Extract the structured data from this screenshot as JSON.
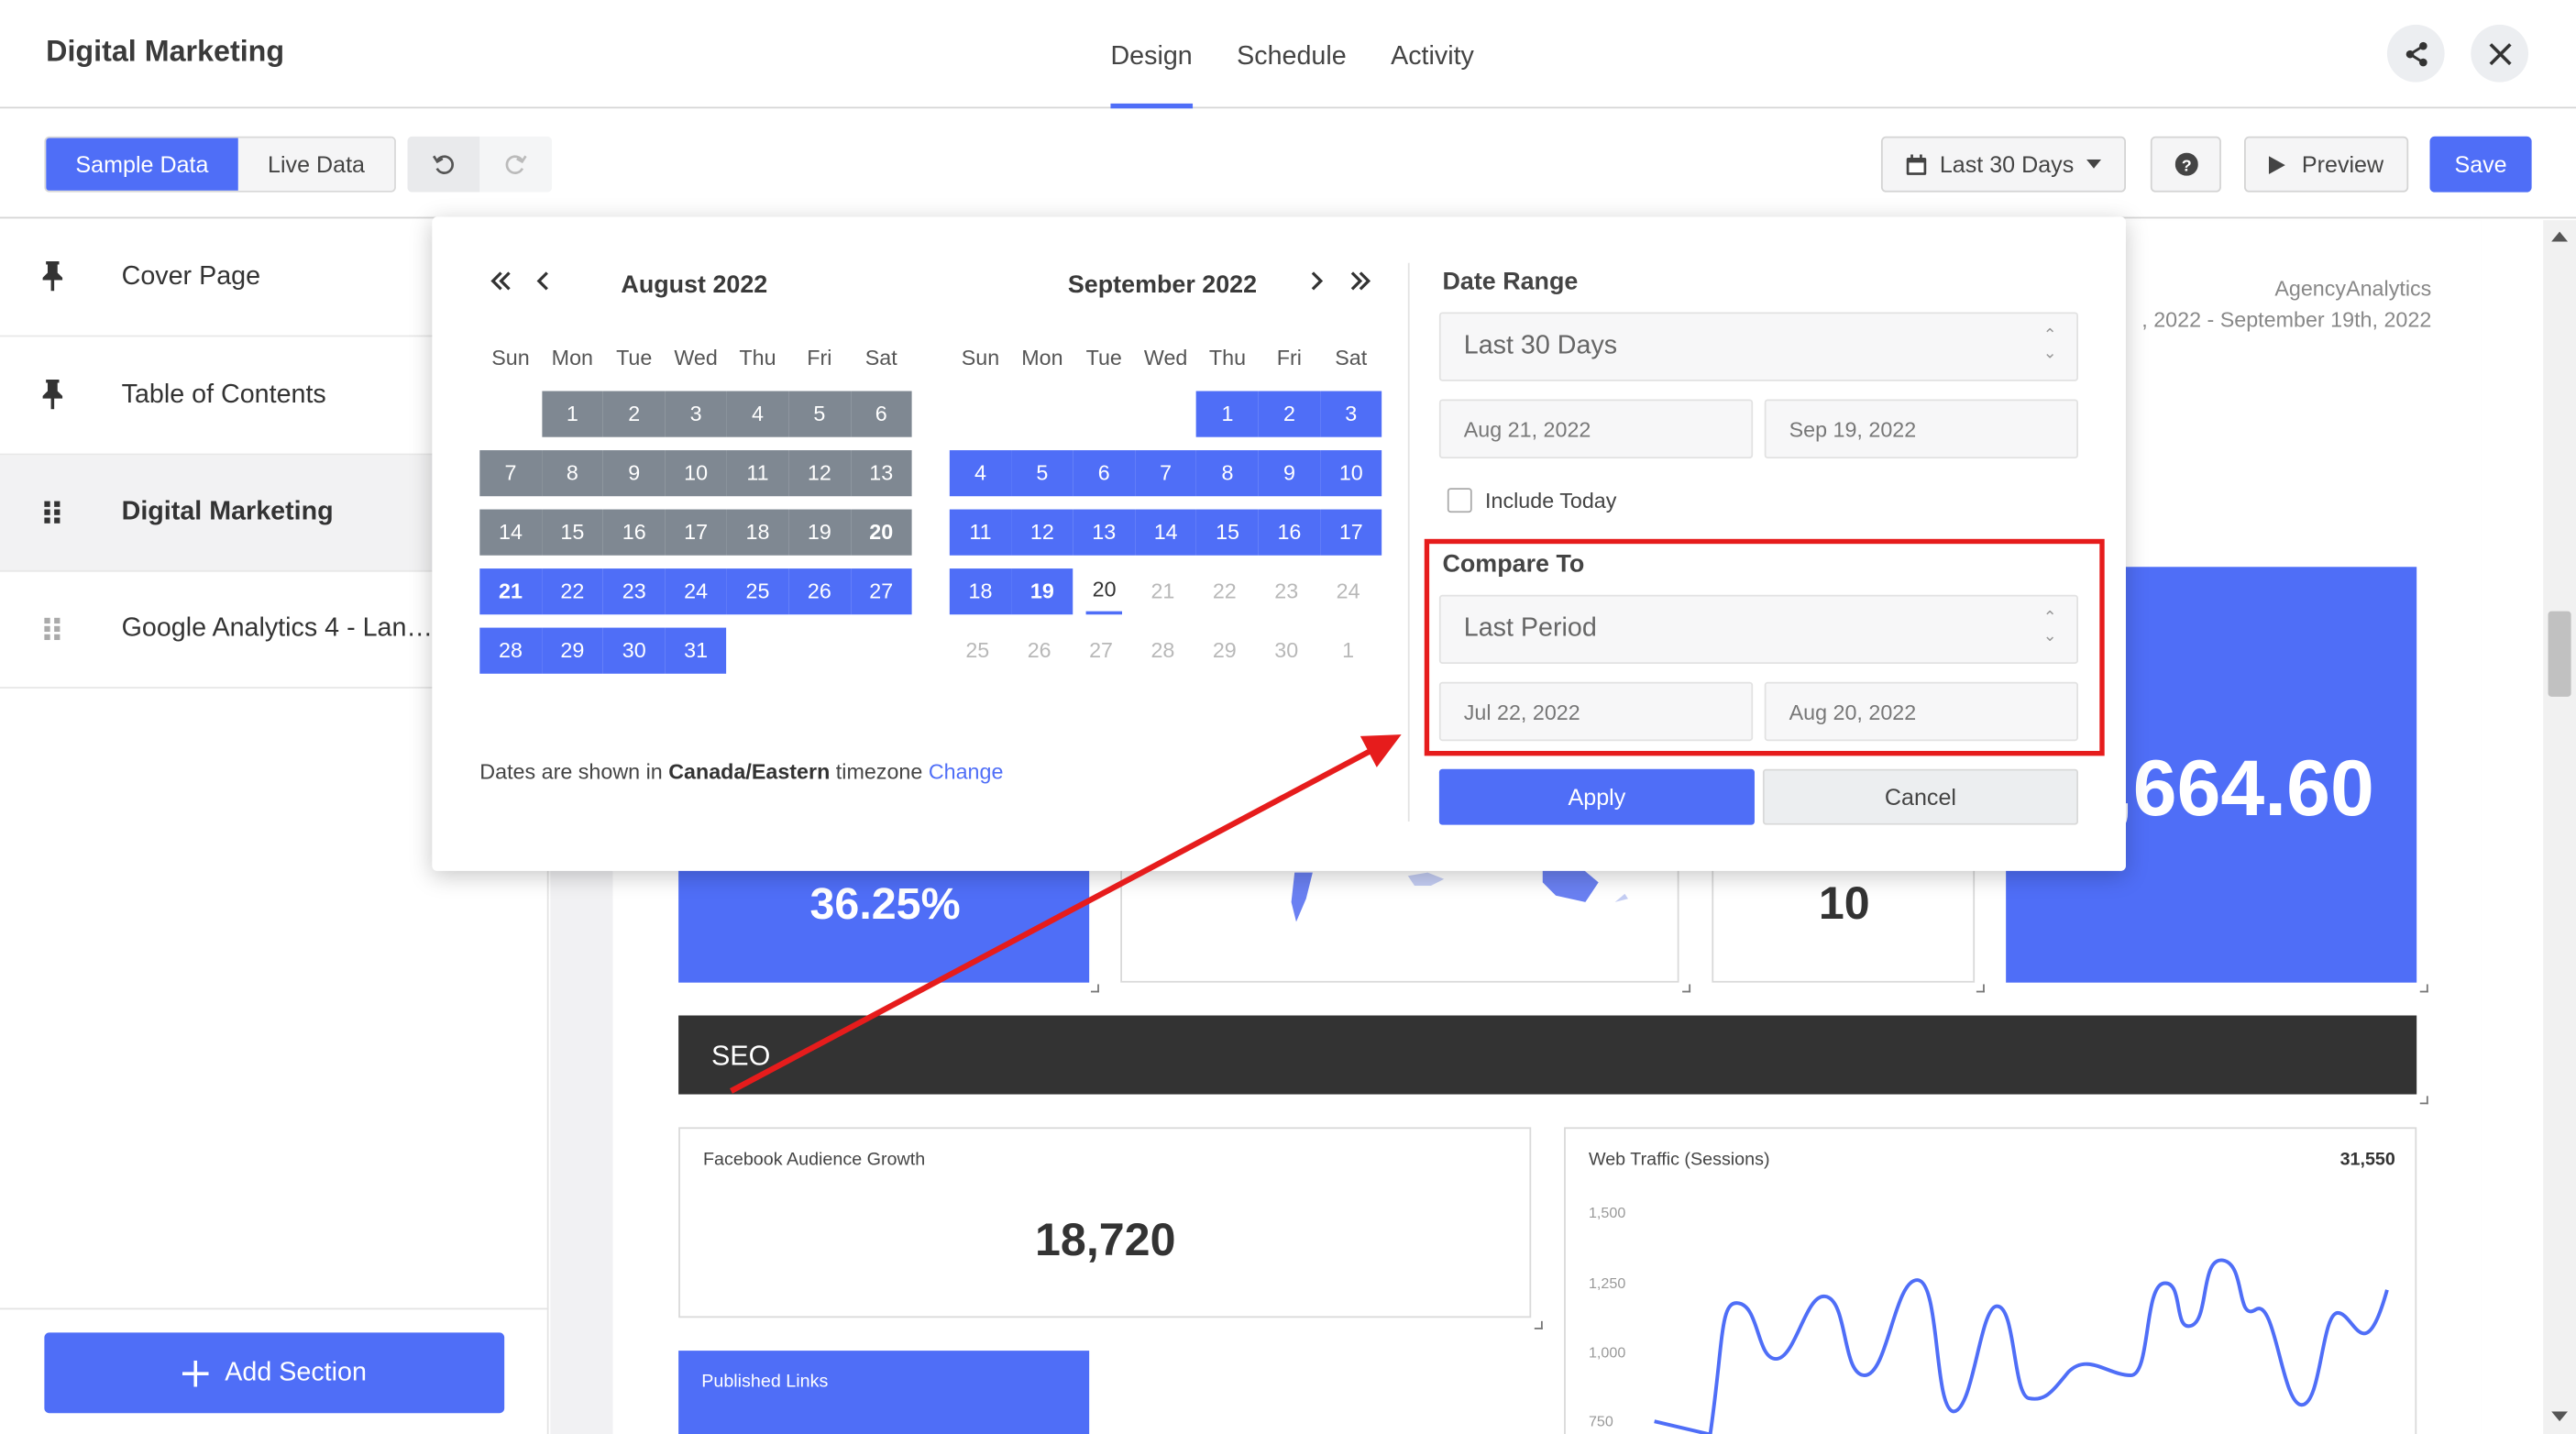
{
  "app": {
    "title": "Digital Marketing"
  },
  "top_tabs": [
    {
      "label": "Design",
      "active": true
    },
    {
      "label": "Schedule",
      "active": false
    },
    {
      "label": "Activity",
      "active": false
    }
  ],
  "toolbar": {
    "sample_data": "Sample Data",
    "live_data": "Live Data",
    "date_range_label": "Last 30 Days",
    "preview_label": "Preview",
    "save_label": "Save"
  },
  "sidebar": {
    "items": [
      {
        "label": "Cover Page",
        "icon": "pin-icon"
      },
      {
        "label": "Table of Contents",
        "icon": "pin-icon"
      },
      {
        "label": "Digital Marketing",
        "icon": "drag-handle-icon"
      },
      {
        "label": "Google Analytics 4 - Lan…",
        "icon": "drag-handle-icon"
      }
    ],
    "add_section": "Add Section"
  },
  "report": {
    "agency_name": "AgencyAnalytics",
    "date_line": ", 2022 - September 19th, 2022",
    "metric_percent": "36.25%",
    "metric_ten": "10",
    "metric_money": ",664.60",
    "seo_title": "SEO",
    "fb_title": "Facebook Audience Growth",
    "fb_value": "18,720",
    "web_title": "Web Traffic (Sessions)",
    "web_total": "31,550",
    "web_ticks": [
      "1,500",
      "1,250",
      "1,000",
      "750"
    ],
    "published_links": "Published Links"
  },
  "picker": {
    "aug": {
      "title": "August 2022",
      "weeks": [
        [
          null,
          "1",
          "2",
          "3",
          "4",
          "5",
          "6"
        ],
        [
          "7",
          "8",
          "9",
          "10",
          "11",
          "12",
          "13"
        ],
        [
          "14",
          "15",
          "16",
          "17",
          "18",
          "19",
          "20"
        ],
        [
          "21",
          "22",
          "23",
          "24",
          "25",
          "26",
          "27"
        ],
        [
          "28",
          "29",
          "30",
          "31",
          null,
          null,
          null
        ]
      ]
    },
    "sep": {
      "title": "September 2022",
      "weeks": [
        [
          null,
          null,
          null,
          null,
          "1",
          "2",
          "3"
        ],
        [
          "4",
          "5",
          "6",
          "7",
          "8",
          "9",
          "10"
        ],
        [
          "11",
          "12",
          "13",
          "14",
          "15",
          "16",
          "17"
        ],
        [
          "18",
          "19",
          "20",
          "21",
          "22",
          "23",
          "24"
        ],
        [
          "25",
          "26",
          "27",
          "28",
          "29",
          "30",
          "1"
        ]
      ]
    },
    "weekdays": [
      "Sun",
      "Mon",
      "Tue",
      "Wed",
      "Thu",
      "Fri",
      "Sat"
    ],
    "tz_prefix": "Dates are shown in ",
    "tz_name": "Canada/Eastern",
    "tz_suffix": " timezone ",
    "tz_change": "Change",
    "date_range_title": "Date Range",
    "date_range_value": "Last 30 Days",
    "range_start": "Aug 21, 2022",
    "range_end": "Sep 19, 2022",
    "include_today": "Include Today",
    "compare_title": "Compare To",
    "compare_value": "Last Period",
    "compare_start": "Jul 22, 2022",
    "compare_end": "Aug 20, 2022",
    "apply": "Apply",
    "cancel": "Cancel"
  },
  "colors": {
    "accent": "#4f6ef7",
    "compare_gray": "#7f8892",
    "annotation_red": "#e61c1c"
  }
}
